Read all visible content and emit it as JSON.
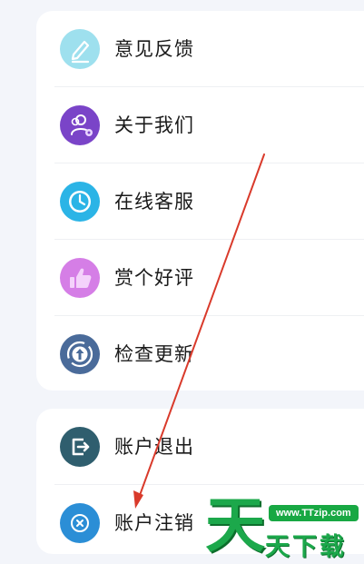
{
  "menu_groups": [
    {
      "items": [
        {
          "label": "意见反馈",
          "icon": "pencil-icon",
          "icon_color": "#9ee0ee"
        },
        {
          "label": "关于我们",
          "icon": "users-icon",
          "icon_color": "#7a44c8"
        },
        {
          "label": "在线客服",
          "icon": "clock-icon",
          "icon_color": "#2bb4e6"
        },
        {
          "label": "赏个好评",
          "icon": "thumbs-up-icon",
          "icon_color": "#d57ee6"
        },
        {
          "label": "检查更新",
          "icon": "update-icon",
          "icon_color": "#4a6b9a"
        }
      ]
    },
    {
      "items": [
        {
          "label": "账户退出",
          "icon": "logout-icon",
          "icon_color": "#2f5e6e"
        },
        {
          "label": "账户注销",
          "icon": "cancel-account-icon",
          "icon_color": "#2b8ed6"
        }
      ]
    }
  ],
  "annotation": {
    "color": "#d93a2b"
  },
  "watermark": {
    "logo_char": "天",
    "url": "www.TTzip.com",
    "text": "天下载",
    "color": "#1ca84b"
  }
}
